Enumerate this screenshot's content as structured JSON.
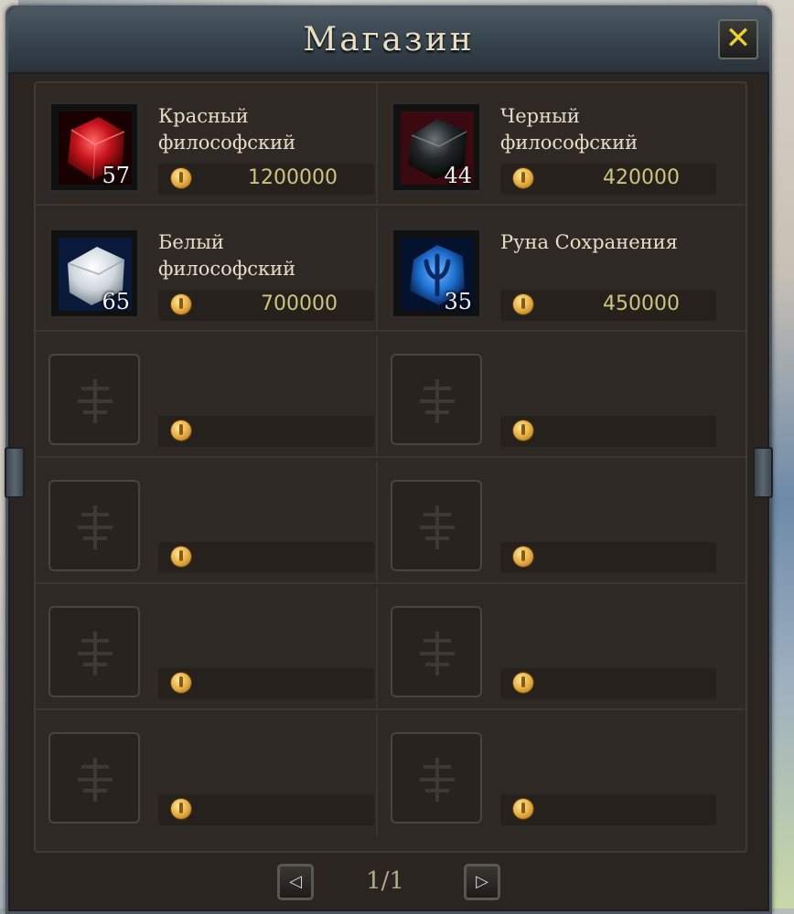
{
  "window": {
    "title": "Магазин",
    "close_symbol": "✕"
  },
  "items": [
    {
      "name_line1": "Красный",
      "name_line2": "философский",
      "quantity": "57",
      "price": "1200000",
      "icon": "red-stone-icon",
      "color": "#c8141c"
    },
    {
      "name_line1": "Черный",
      "name_line2": "философский",
      "quantity": "44",
      "price": "420000",
      "icon": "black-stone-icon",
      "color": "#1a1d1f"
    },
    {
      "name_line1": "Белый",
      "name_line2": "философский",
      "quantity": "65",
      "price": "700000",
      "icon": "white-stone-icon",
      "color": "#e8ecef"
    },
    {
      "name_line1": "Руна Сохранения",
      "name_line2": "",
      "quantity": "35",
      "price": "450000",
      "icon": "blue-rune-icon",
      "color": "#1e6fd0"
    }
  ],
  "empty_slots": 8,
  "pagination": {
    "prev_symbol": "◁",
    "next_symbol": "▷",
    "page_label": "1/1"
  },
  "colors": {
    "title": "#e9dfc0",
    "price": "#cfc37e",
    "close": "#f0d030"
  }
}
